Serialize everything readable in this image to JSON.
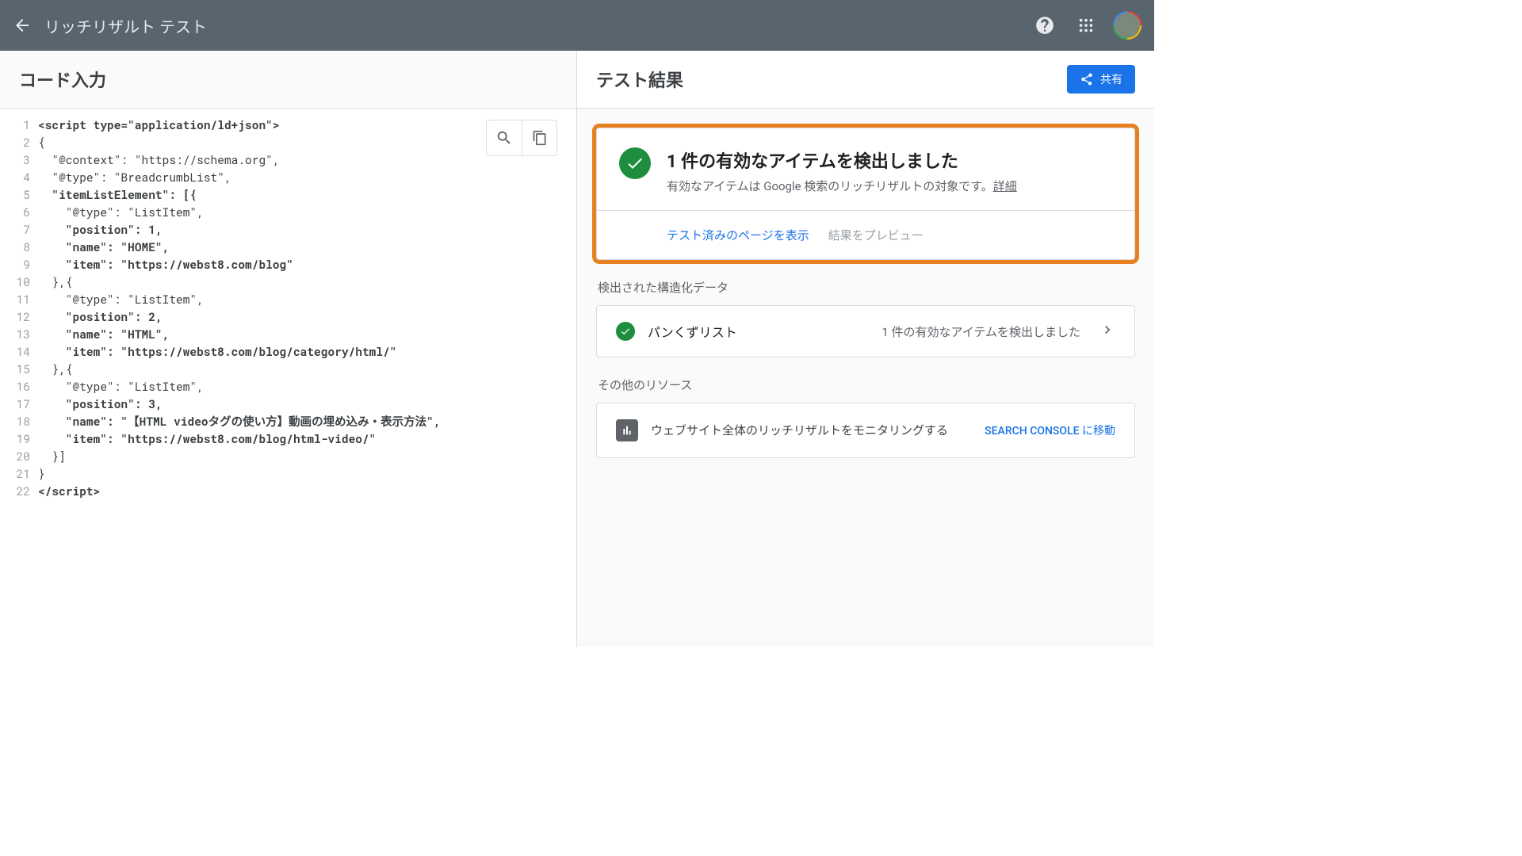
{
  "header": {
    "title": "リッチリザルト テスト"
  },
  "left": {
    "title": "コード入力",
    "code_lines": [
      {
        "n": 1,
        "t": "<script type=\"application/ld+json\">",
        "bold": true
      },
      {
        "n": 2,
        "t": "{"
      },
      {
        "n": 3,
        "t": "  \"@context\": \"https://schema.org\","
      },
      {
        "n": 4,
        "t": "  \"@type\": \"BreadcrumbList\","
      },
      {
        "n": 5,
        "t": "  \"itemListElement\": [{",
        "bold": true
      },
      {
        "n": 6,
        "t": "    \"@type\": \"ListItem\","
      },
      {
        "n": 7,
        "t": "    \"position\": 1,",
        "bold": true
      },
      {
        "n": 8,
        "t": "    \"name\": \"HOME\",",
        "bold": true
      },
      {
        "n": 9,
        "t": "    \"item\": \"https://webst8.com/blog\"",
        "bold": true
      },
      {
        "n": 10,
        "t": "  },{"
      },
      {
        "n": 11,
        "t": "    \"@type\": \"ListItem\","
      },
      {
        "n": 12,
        "t": "    \"position\": 2,",
        "bold": true
      },
      {
        "n": 13,
        "t": "    \"name\": \"HTML\",",
        "bold": true
      },
      {
        "n": 14,
        "t": "    \"item\": \"https://webst8.com/blog/category/html/\"",
        "bold": true
      },
      {
        "n": 15,
        "t": "  },{"
      },
      {
        "n": 16,
        "t": "    \"@type\": \"ListItem\","
      },
      {
        "n": 17,
        "t": "    \"position\": 3,",
        "bold": true
      },
      {
        "n": 18,
        "t": "    \"name\": \"【HTML videoタグの使い方】動画の埋め込み・表示方法\",",
        "bold": true
      },
      {
        "n": 19,
        "t": "    \"item\": \"https://webst8.com/blog/html-video/\"",
        "bold": true
      },
      {
        "n": 20,
        "t": "  }]"
      },
      {
        "n": 21,
        "t": "}"
      },
      {
        "n": 22,
        "t": "</script>",
        "bold": true
      }
    ]
  },
  "right": {
    "title": "テスト結果",
    "share": "共有",
    "summary": {
      "title": "1 件の有効なアイテムを検出しました",
      "subtitle": "有効なアイテムは Google 検索のリッチリザルトの対象です。",
      "details_link": "詳細",
      "action_preview_page": "テスト済みのページを表示",
      "action_preview_result": "結果をプレビュー"
    },
    "detected_label": "検出された構造化データ",
    "detected_item": {
      "name": "パンくずリスト",
      "desc": "1 件の有効なアイテムを検出しました"
    },
    "other_label": "その他のリソース",
    "resource": {
      "text": "ウェブサイト全体のリッチリザルトをモニタリングする",
      "link": "SEARCH CONSOLE に移動"
    }
  }
}
